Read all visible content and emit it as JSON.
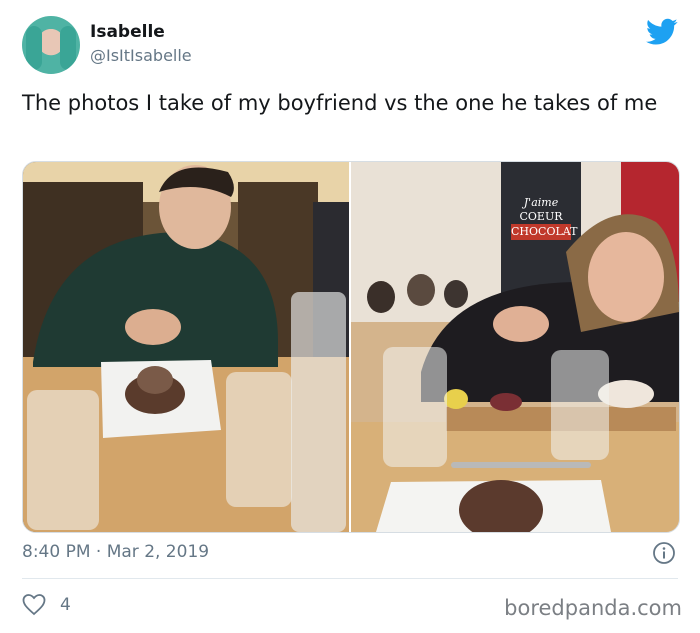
{
  "author": {
    "name": "Isabelle",
    "handle": "@IsItIsabelle"
  },
  "tweet": {
    "text": "The photos I take of my boyfriend vs the one he takes of me",
    "timestamp": "8:40 PM · Mar 2, 2019",
    "likes": "4"
  },
  "media": {
    "left_photo": "man-eating-chocolate-dessert",
    "right_photo": "woman-eating-chocolate-dessert"
  },
  "sign": {
    "line1": "J'aime",
    "line2": "COEUR",
    "line3": "CHOCOLAT"
  },
  "watermark": "boredpanda.com",
  "colors": {
    "twitter_blue": "#1da1f2",
    "secondary_text": "#657786"
  }
}
